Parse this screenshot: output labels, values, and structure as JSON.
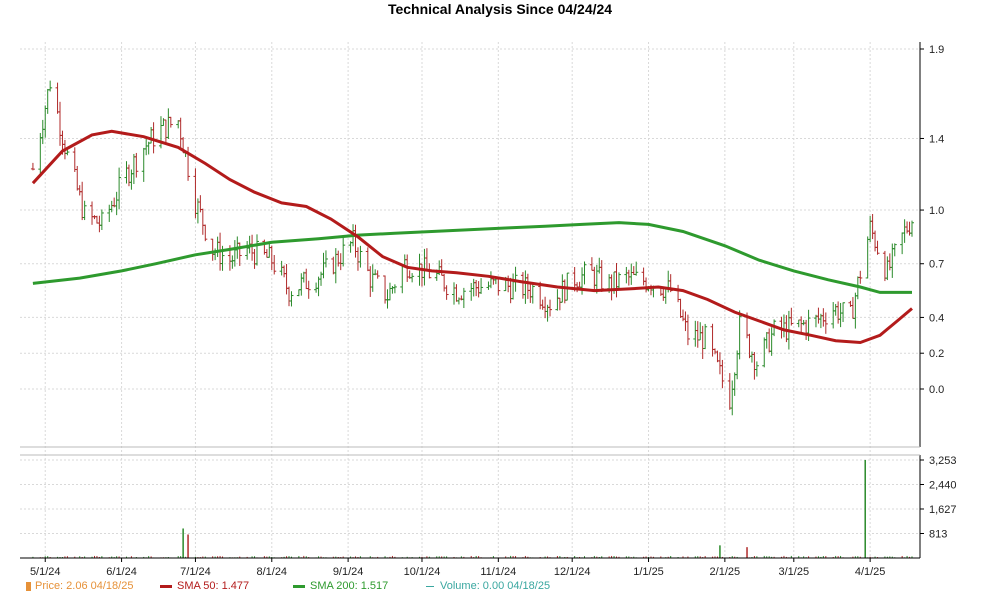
{
  "chart_data": {
    "type": "candlestick",
    "title": "Technical Analysis Since 04/24/24",
    "price_axis": {
      "ticks": [
        1.9,
        1.4,
        1.0,
        0.7,
        0.4,
        0.2,
        0.0
      ],
      "tick_labels": [
        "1.9",
        "1.4",
        "1.0",
        "0.7",
        "0.4",
        "0.2",
        "0.0"
      ]
    },
    "volume_axis": {
      "ticks": [
        3253,
        2440,
        1627,
        813
      ],
      "tick_labels": [
        "3,253",
        "2,440",
        "1,627",
        "813"
      ]
    },
    "x_tick_labels": [
      "5/1/24",
      "6/1/24",
      "7/1/24",
      "8/1/24",
      "9/1/24",
      "10/1/24",
      "11/1/24",
      "12/1/24",
      "1/1/25",
      "2/1/25",
      "3/1/25",
      "4/1/25"
    ],
    "date_range": [
      "2024-04-24",
      "2025-04-18"
    ],
    "grid": true,
    "legend_position": "bottom",
    "series": [
      {
        "name": "Price",
        "kind": "ohlc",
        "value": "2.06",
        "date": "04/18/25",
        "approx_close_by_month": [
          {
            "date": "2024-04-26",
            "close": 1.23
          },
          {
            "date": "2024-05-03",
            "close": 1.72
          },
          {
            "date": "2024-05-10",
            "close": 1.3
          },
          {
            "date": "2024-05-17",
            "close": 0.97
          },
          {
            "date": "2024-05-24",
            "close": 0.92
          },
          {
            "date": "2024-06-03",
            "close": 1.2
          },
          {
            "date": "2024-06-10",
            "close": 1.35
          },
          {
            "date": "2024-06-17",
            "close": 1.45
          },
          {
            "date": "2024-06-24",
            "close": 1.5
          },
          {
            "date": "2024-07-01",
            "close": 1.05
          },
          {
            "date": "2024-07-08",
            "close": 0.78
          },
          {
            "date": "2024-07-15",
            "close": 0.72
          },
          {
            "date": "2024-07-22",
            "close": 0.78
          },
          {
            "date": "2024-08-01",
            "close": 0.72
          },
          {
            "date": "2024-08-08",
            "close": 0.55
          },
          {
            "date": "2024-08-15",
            "close": 0.6
          },
          {
            "date": "2024-08-22",
            "close": 0.65
          },
          {
            "date": "2024-09-03",
            "close": 0.82
          },
          {
            "date": "2024-09-10",
            "close": 0.62
          },
          {
            "date": "2024-09-17",
            "close": 0.52
          },
          {
            "date": "2024-09-24",
            "close": 0.7
          },
          {
            "date": "2024-10-01",
            "close": 0.67
          },
          {
            "date": "2024-10-08",
            "close": 0.62
          },
          {
            "date": "2024-10-15",
            "close": 0.55
          },
          {
            "date": "2024-10-22",
            "close": 0.57
          },
          {
            "date": "2024-11-01",
            "close": 0.58
          },
          {
            "date": "2024-11-08",
            "close": 0.57
          },
          {
            "date": "2024-11-15",
            "close": 0.56
          },
          {
            "date": "2024-11-22",
            "close": 0.48
          },
          {
            "date": "2024-12-02",
            "close": 0.62
          },
          {
            "date": "2024-12-09",
            "close": 0.64
          },
          {
            "date": "2024-12-16",
            "close": 0.58
          },
          {
            "date": "2024-12-23",
            "close": 0.62
          },
          {
            "date": "2025-01-02",
            "close": 0.6
          },
          {
            "date": "2025-01-10",
            "close": 0.55
          },
          {
            "date": "2025-01-17",
            "close": 0.3
          },
          {
            "date": "2025-01-24",
            "close": 0.28
          },
          {
            "date": "2025-02-03",
            "close": -0.05
          },
          {
            "date": "2025-02-07",
            "close": 0.35
          },
          {
            "date": "2025-02-14",
            "close": 0.15
          },
          {
            "date": "2025-02-21",
            "close": 0.32
          },
          {
            "date": "2025-03-03",
            "close": 0.35
          },
          {
            "date": "2025-03-10",
            "close": 0.38
          },
          {
            "date": "2025-03-17",
            "close": 0.45
          },
          {
            "date": "2025-03-24",
            "close": 0.4
          },
          {
            "date": "2025-04-01",
            "close": 0.9
          },
          {
            "date": "2025-04-08",
            "close": 0.65
          },
          {
            "date": "2025-04-15",
            "close": 0.88
          },
          {
            "date": "2025-04-18",
            "close": 0.95
          }
        ]
      },
      {
        "name": "SMA 50",
        "kind": "line",
        "value": "1.477",
        "points": [
          {
            "date": "2024-04-26",
            "value": 1.15
          },
          {
            "date": "2024-05-08",
            "value": 1.33
          },
          {
            "date": "2024-05-20",
            "value": 1.42
          },
          {
            "date": "2024-05-28",
            "value": 1.44
          },
          {
            "date": "2024-06-10",
            "value": 1.41
          },
          {
            "date": "2024-06-24",
            "value": 1.35
          },
          {
            "date": "2024-07-05",
            "value": 1.26
          },
          {
            "date": "2024-07-15",
            "value": 1.17
          },
          {
            "date": "2024-07-25",
            "value": 1.1
          },
          {
            "date": "2024-08-05",
            "value": 1.04
          },
          {
            "date": "2024-08-15",
            "value": 1.02
          },
          {
            "date": "2024-08-25",
            "value": 0.95
          },
          {
            "date": "2024-09-05",
            "value": 0.85
          },
          {
            "date": "2024-09-15",
            "value": 0.74
          },
          {
            "date": "2024-09-25",
            "value": 0.68
          },
          {
            "date": "2024-10-05",
            "value": 0.66
          },
          {
            "date": "2024-10-15",
            "value": 0.65
          },
          {
            "date": "2024-10-28",
            "value": 0.63
          },
          {
            "date": "2024-11-10",
            "value": 0.6
          },
          {
            "date": "2024-11-25",
            "value": 0.57
          },
          {
            "date": "2024-12-10",
            "value": 0.55
          },
          {
            "date": "2024-12-25",
            "value": 0.56
          },
          {
            "date": "2025-01-05",
            "value": 0.57
          },
          {
            "date": "2025-01-15",
            "value": 0.55
          },
          {
            "date": "2025-01-25",
            "value": 0.5
          },
          {
            "date": "2025-02-05",
            "value": 0.43
          },
          {
            "date": "2025-02-15",
            "value": 0.38
          },
          {
            "date": "2025-02-25",
            "value": 0.33
          },
          {
            "date": "2025-03-08",
            "value": 0.3
          },
          {
            "date": "2025-03-18",
            "value": 0.27
          },
          {
            "date": "2025-03-28",
            "value": 0.26
          },
          {
            "date": "2025-04-05",
            "value": 0.3
          },
          {
            "date": "2025-04-12",
            "value": 0.38
          },
          {
            "date": "2025-04-18",
            "value": 0.45
          }
        ]
      },
      {
        "name": "SMA 200",
        "kind": "line",
        "value": "1.517",
        "points": [
          {
            "date": "2024-04-26",
            "value": 0.59
          },
          {
            "date": "2024-05-15",
            "value": 0.62
          },
          {
            "date": "2024-06-01",
            "value": 0.66
          },
          {
            "date": "2024-06-15",
            "value": 0.7
          },
          {
            "date": "2024-07-01",
            "value": 0.75
          },
          {
            "date": "2024-07-15",
            "value": 0.78
          },
          {
            "date": "2024-08-01",
            "value": 0.82
          },
          {
            "date": "2024-08-20",
            "value": 0.84
          },
          {
            "date": "2024-09-05",
            "value": 0.86
          },
          {
            "date": "2024-09-20",
            "value": 0.87
          },
          {
            "date": "2024-10-05",
            "value": 0.88
          },
          {
            "date": "2024-10-20",
            "value": 0.89
          },
          {
            "date": "2024-11-05",
            "value": 0.9
          },
          {
            "date": "2024-11-20",
            "value": 0.91
          },
          {
            "date": "2024-12-05",
            "value": 0.92
          },
          {
            "date": "2024-12-20",
            "value": 0.93
          },
          {
            "date": "2025-01-01",
            "value": 0.92
          },
          {
            "date": "2025-01-15",
            "value": 0.88
          },
          {
            "date": "2025-02-01",
            "value": 0.8
          },
          {
            "date": "2025-02-15",
            "value": 0.72
          },
          {
            "date": "2025-03-01",
            "value": 0.66
          },
          {
            "date": "2025-03-15",
            "value": 0.61
          },
          {
            "date": "2025-03-28",
            "value": 0.57
          },
          {
            "date": "2025-04-05",
            "value": 0.54
          },
          {
            "date": "2025-04-18",
            "value": 0.54
          }
        ]
      },
      {
        "name": "Volume",
        "kind": "bar",
        "value": "0.00",
        "date": "04/18/25",
        "notable": [
          {
            "date": "2024-06-26",
            "value": 980
          },
          {
            "date": "2024-06-28",
            "value": 780
          },
          {
            "date": "2025-01-30",
            "value": 420
          },
          {
            "date": "2025-02-10",
            "value": 360
          },
          {
            "date": "2025-03-30",
            "value": 3253
          }
        ]
      }
    ],
    "colors": {
      "up": "#2a8a2a",
      "down": "#b02a2a",
      "sma50": "#b31b1b",
      "sma200": "#2e9a2e",
      "price_legend": "#e69138",
      "volume_legend": "#3aa7a0",
      "grid": "#d9d9d9",
      "axis": "#000000"
    }
  },
  "legend": {
    "price": "Price: 2.06  04/18/25",
    "sma50": "SMA 50: 1.477",
    "sma200": "SMA 200: 1.517",
    "volume": "Volume: 0.00  04/18/25"
  }
}
